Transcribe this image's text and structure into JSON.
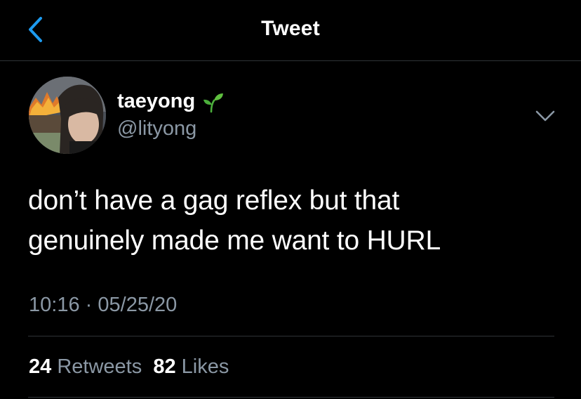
{
  "header": {
    "title": "Tweet",
    "back_icon": "chevron-left-icon",
    "accent_color": "#1d9bf0"
  },
  "tweet": {
    "author": {
      "display_name": "taeyong",
      "name_emoji": "seedling-icon",
      "handle": "@lityong"
    },
    "text_lines": [
      "don’t have a gag reflex but that",
      "genuinely made me want to HURL"
    ],
    "time": "10:16",
    "separator": "·",
    "date": "05/25/20",
    "stats": {
      "retweets_count": "24",
      "retweets_label": "Retweets",
      "likes_count": "82",
      "likes_label": "Likes"
    },
    "more_icon": "chevron-down-icon"
  },
  "colors": {
    "background": "#000000",
    "text": "#ffffff",
    "muted": "#8b98a5",
    "divider": "#2f3336"
  }
}
